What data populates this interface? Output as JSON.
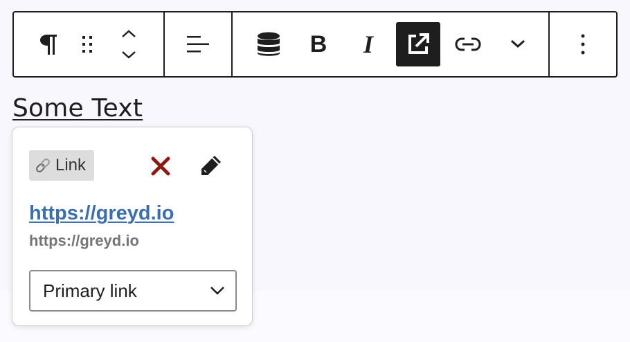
{
  "toolbar": {
    "groups": [
      {
        "buttons": [
          {
            "name": "paragraph-button",
            "icon": "pilcrow-icon"
          },
          {
            "name": "drag-handle-button",
            "icon": "drag-handle-icon"
          },
          {
            "name": "move-up-button",
            "icon": "chevron-up-icon"
          },
          {
            "name": "move-down-button",
            "icon": "chevron-down-icon"
          }
        ]
      },
      {
        "buttons": [
          {
            "name": "align-button",
            "icon": "align-left-icon"
          }
        ]
      },
      {
        "buttons": [
          {
            "name": "dynamic-content-button",
            "icon": "database-icon"
          },
          {
            "name": "bold-button",
            "icon": "bold-icon",
            "label": "B"
          },
          {
            "name": "italic-button",
            "icon": "italic-icon",
            "label": "I"
          },
          {
            "name": "external-link-button",
            "icon": "external-link-icon",
            "active": true
          },
          {
            "name": "link-button",
            "icon": "link-icon"
          },
          {
            "name": "more-formatting-button",
            "icon": "chevron-down-icon"
          }
        ]
      },
      {
        "buttons": [
          {
            "name": "options-button",
            "icon": "more-vertical-icon"
          }
        ]
      }
    ],
    "active_color": "#1e1e1e"
  },
  "content": {
    "text": "Some Text"
  },
  "popover": {
    "badge_label": "Link",
    "badge_icon": "chain-link-icon",
    "remove_icon": "cross-icon",
    "edit_icon": "pencil-icon",
    "url": "https://greyd.io",
    "url_secondary": "https://greyd.io",
    "select_value": "Primary link",
    "colors": {
      "url": "#3a6fb0",
      "remove": "#8b1a10",
      "secondary": "#757575"
    }
  }
}
